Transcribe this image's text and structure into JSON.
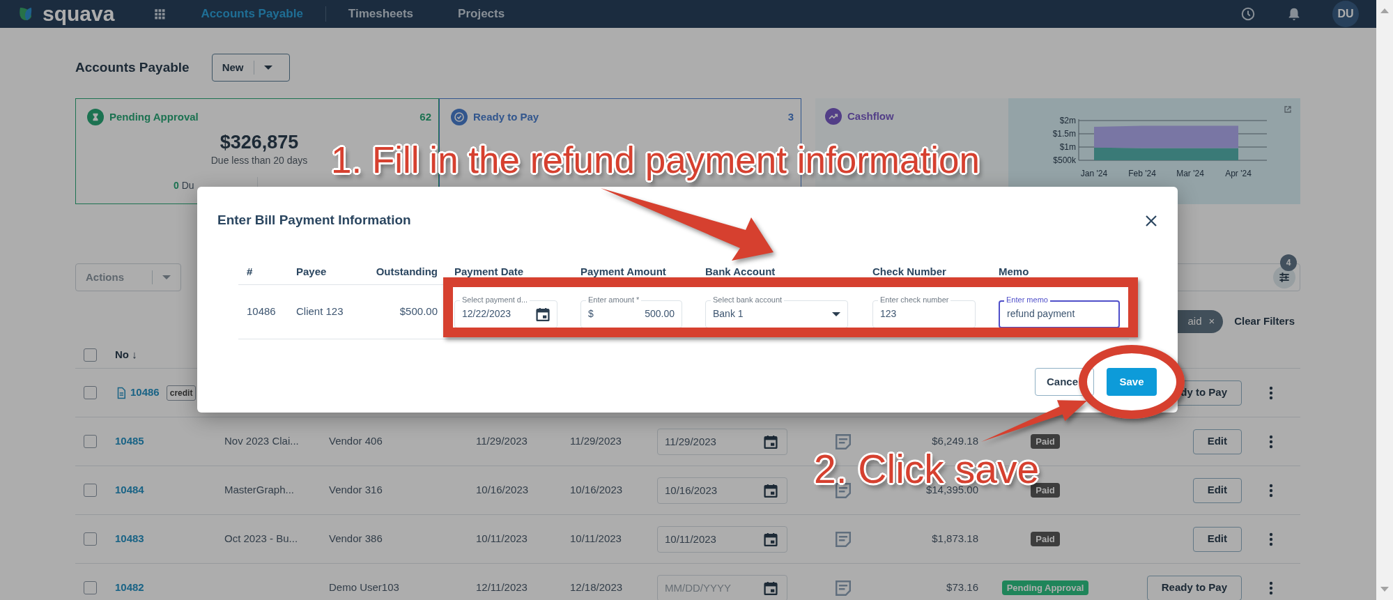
{
  "navbar": {
    "logo": "squava",
    "tabs": [
      {
        "label": "Accounts Payable",
        "selected": true
      },
      {
        "label": "Timesheets",
        "selected": false
      },
      {
        "label": "Projects",
        "selected": false
      }
    ],
    "avatar": "DU"
  },
  "page": {
    "title": "Accounts Payable",
    "new_button": "New"
  },
  "cards": [
    {
      "kind": "pending",
      "title": "Pending Approval",
      "count": "62",
      "amount": "$326,875",
      "caption": "Due less than 20 days",
      "footer_count": "0",
      "footer_text": "Du"
    },
    {
      "kind": "ready",
      "title": "Ready to Pay",
      "count": "3"
    },
    {
      "kind": "cashflow",
      "title": "Cashflow",
      "chart_data": {
        "type": "area",
        "stacked": true,
        "categories": [
          "Jan '24",
          "Feb '24",
          "Mar '24",
          "Apr '24"
        ],
        "ylim": [
          500000,
          2000000
        ],
        "yticks": [
          {
            "value": 500000,
            "label": "$500k"
          },
          {
            "value": 1000000,
            "label": "$1m"
          },
          {
            "value": 1500000,
            "label": "$1.5m"
          },
          {
            "value": 2000000,
            "label": "$2m"
          }
        ],
        "series": [
          {
            "color": "#56b4b0",
            "values": [
              980000,
              960000,
              960000,
              960000
            ]
          },
          {
            "color": "#b3aef2",
            "values": [
              780000,
              840000,
              840000,
              840000
            ]
          }
        ]
      }
    }
  ],
  "toolbar": {
    "actions": {
      "label": "Actions",
      "disabled": true
    },
    "filter_count": "4",
    "chips": [
      {
        "label": "aid",
        "remove": "×"
      }
    ],
    "clear": "Clear Filters"
  },
  "table": {
    "header": {
      "label": "No",
      "sort": "↓",
      "checked": false
    },
    "rows": [
      {
        "no": "10486",
        "checked": false,
        "document": true,
        "tag": "credit",
        "action": "dy to Pay"
      },
      {
        "no": "10485",
        "checked": false,
        "document": false,
        "description": "Nov 2023 Clai...",
        "vendor": "Vendor 406",
        "date": "11/29/2023",
        "due": "11/29/2023",
        "pay_date": {
          "value": "11/29/2023"
        },
        "amount": "$6,249.18",
        "status": {
          "label": "Paid",
          "kind": "paid"
        },
        "action": "Edit"
      },
      {
        "no": "10484",
        "checked": false,
        "document": false,
        "description": "MasterGraph...",
        "vendor": "Vendor 316",
        "date": "10/16/2023",
        "due": "10/16/2023",
        "pay_date": {
          "value": "10/16/2023"
        },
        "amount": "$14,395.00",
        "status": {
          "label": "Paid",
          "kind": "paid"
        },
        "action": "Edit"
      },
      {
        "no": "10483",
        "checked": false,
        "document": false,
        "description": "Oct 2023 - Bu...",
        "vendor": "Vendor 386",
        "date": "10/11/2023",
        "due": "10/11/2023",
        "pay_date": {
          "value": "10/11/2023"
        },
        "amount": "$1,873.18",
        "status": {
          "label": "Paid",
          "kind": "paid"
        },
        "action": "Edit"
      },
      {
        "no": "10482",
        "checked": false,
        "document": false,
        "vendor": "Demo User103",
        "date": "12/11/2023",
        "due": "12/18/2023",
        "pay_date": {
          "placeholder": "MM/DD/YYYY"
        },
        "amount": "$73.16",
        "status": {
          "label": "Pending Approval",
          "kind": "pending"
        },
        "action": "Ready to Pay"
      }
    ]
  },
  "modal": {
    "title": "Enter Bill Payment Information",
    "columns": [
      "#",
      "Payee",
      "Outstanding",
      "Payment Date",
      "Payment Amount",
      "Bank Account",
      "Check Number",
      "Memo"
    ],
    "rows": [
      {
        "number": "10486",
        "payee": "Client 123",
        "outstanding": "$500.00",
        "fields": [
          {
            "kind": "date",
            "label": "Select payment d...",
            "value": "12/22/2023",
            "focused": false
          },
          {
            "kind": "amount",
            "label": "Enter amount *",
            "prefix": "$",
            "value": "500.00",
            "focused": false
          },
          {
            "kind": "select",
            "label": "Select bank account",
            "value": "Bank 1",
            "focused": false
          },
          {
            "kind": "text",
            "label": "Enter check number",
            "value": "123",
            "focused": false
          },
          {
            "kind": "text",
            "label": "Enter memo",
            "value": "refund payment",
            "focused": true
          }
        ]
      }
    ],
    "buttons": [
      {
        "kind": "secondary",
        "label": "Cance"
      },
      {
        "kind": "primary",
        "label": "Save"
      }
    ]
  },
  "annotations": [
    {
      "kind": "text",
      "text": "1. Fill in the refund payment information"
    },
    {
      "kind": "arrow"
    },
    {
      "kind": "box"
    },
    {
      "kind": "circle"
    },
    {
      "kind": "arrow"
    },
    {
      "kind": "text",
      "text": "2. Click save"
    }
  ]
}
